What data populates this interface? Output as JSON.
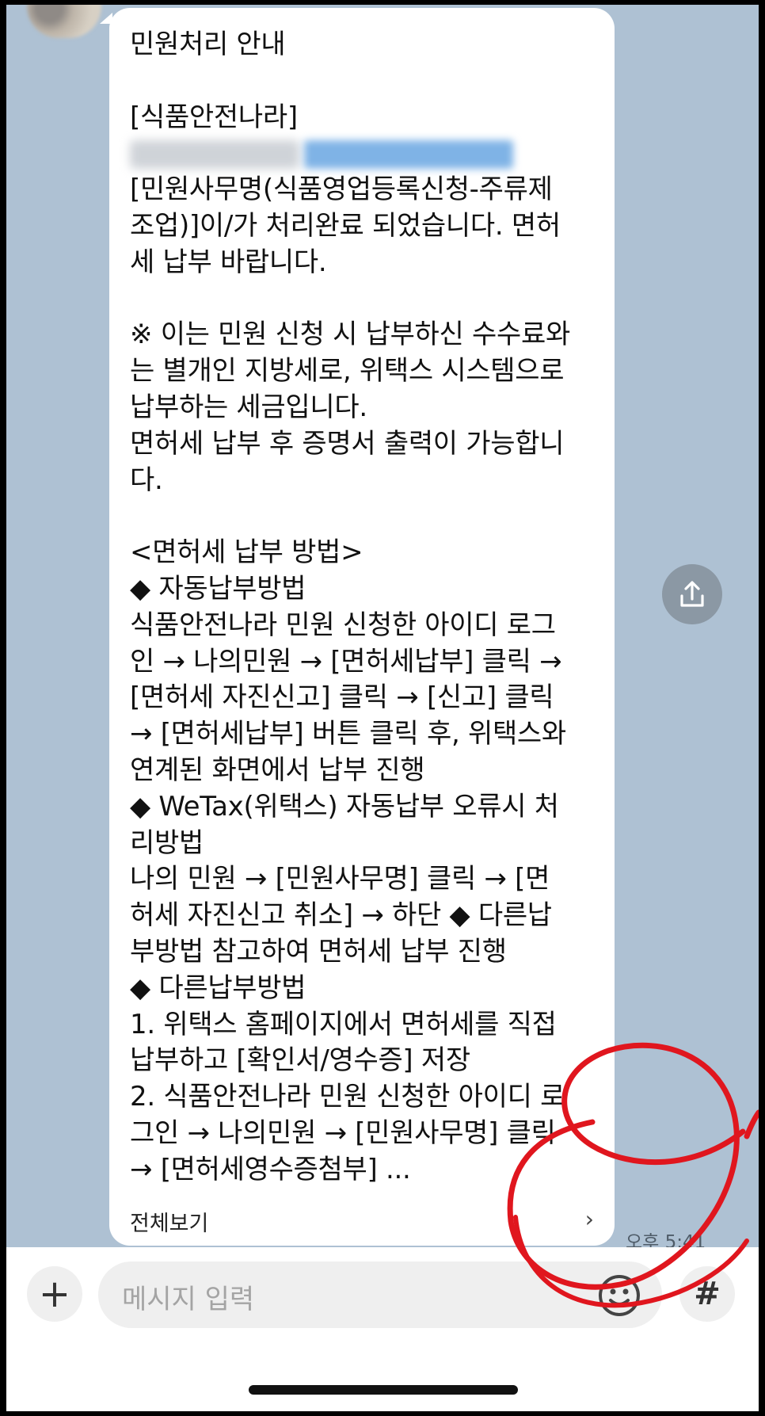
{
  "chat": {
    "message": {
      "line_title": "민원처리 안내",
      "line_site": "[식품안전나라]",
      "body": "[민원사무명(식품영업등록신청-주류제\n조업)]이/가 처리완료 되었습니다. 면허\n세 납부 바랍니다.\n\n※ 이는 민원 신청 시 납부하신 수수료와\n는 별개인 지방세로, 위택스 시스템으로\n납부하는 세금입니다.\n면허세 납부 후 증명서 출력이 가능합니\n다.\n\n<면허세 납부 방법>\n◆ 자동납부방법\n식품안전나라 민원 신청한 아이디 로그\n인 → 나의민원 → [면허세납부] 클릭 →\n[면허세 자진신고] 클릭 → [신고] 클릭\n→ [면허세납부] 버튼 클릭 후, 위택스와\n연계된 화면에서 납부 진행\n◆ WeTax(위택스) 자동납부 오류시 처\n리방법\n나의 민원 → [민원사무명] 클릭 → [면\n허세 자진신고 취소] → 하단 ◆ 다른납\n부방법 참고하여 면허세 납부 진행\n◆ 다른납부방법\n1. 위택스 홈페이지에서 면허세를 직접\n납부하고 [확인서/영수증] 저장\n2. 식품안전나라 민원 신청한 아이디 로\n그인 → 나의민원 → [민원사무명] 클릭\n→ [면허세영수증첨부] ...",
      "view_all_label": "전체보기",
      "view_all_chevron": "›",
      "timestamp": "오후 5:41"
    },
    "icons": {
      "share": "share-upload-icon",
      "emoji": "emoji-icon",
      "annotation": "red-circle-annotation"
    }
  },
  "composer": {
    "plus_label": "+",
    "placeholder": "메시지 입력",
    "hash_label": "#"
  },
  "colors": {
    "chat_background": "#aec1d3",
    "bubble": "#ffffff",
    "share_button": "#8b98a4",
    "annotation": "#e0161e"
  }
}
